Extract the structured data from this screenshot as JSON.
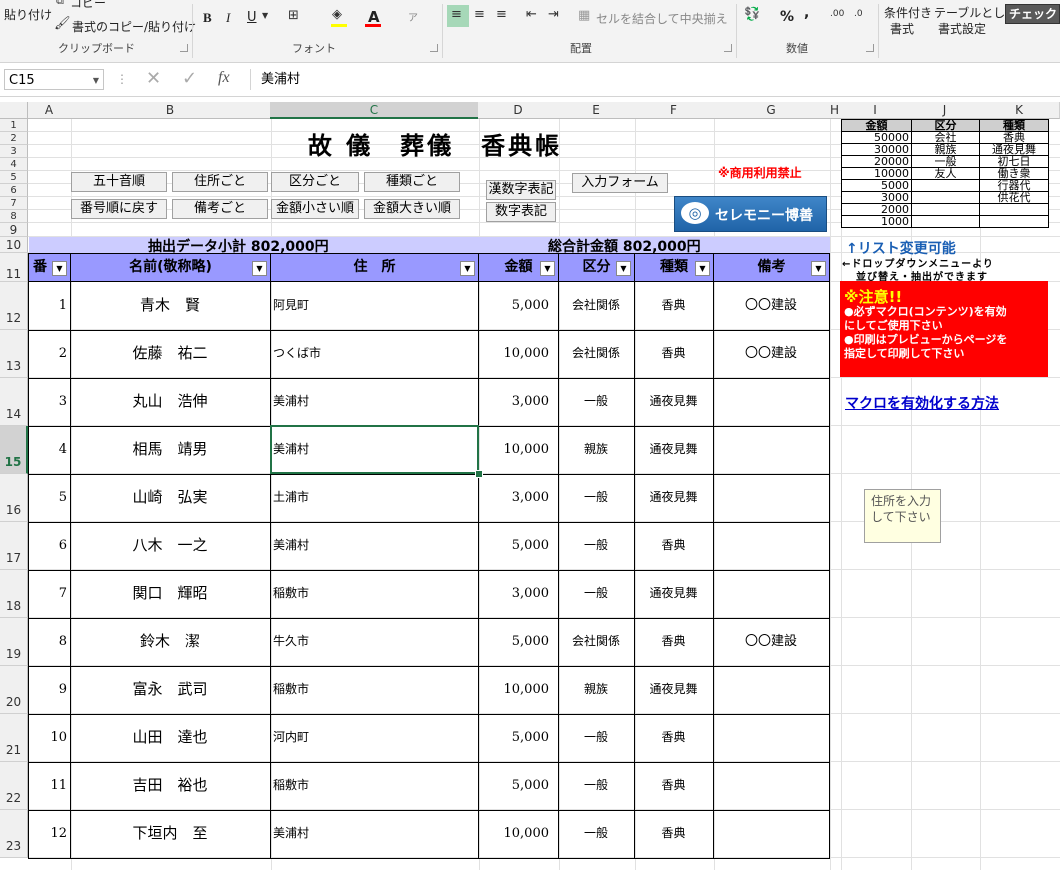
{
  "ribbon": {
    "paste_label": "貼り付け",
    "copy_label": "コピー",
    "format_painter_label": "書式のコピー/貼り付け",
    "clipboard_group": "クリップボード",
    "font_group": "フォント",
    "bold": "B",
    "italic": "I",
    "underline": "U",
    "font_color_letter": "A",
    "alignment_group": "配置",
    "merge_center_label": "セルを結合して中央揃え",
    "number_group": "数値",
    "percent": "%",
    "comma": ",",
    "conditional_format_line1": "条件付き",
    "conditional_format_line2": "書式",
    "table_format_line1": "テーブルとして",
    "table_format_line2": "書式設定",
    "check_label": "チェック"
  },
  "formula_bar": {
    "name_box": "C15",
    "fx": "fx",
    "content": "美浦村"
  },
  "columns": [
    "A",
    "B",
    "C",
    "D",
    "E",
    "F",
    "G",
    "H",
    "I",
    "J",
    "K"
  ],
  "sheet": {
    "title": "故 儀　葬儀　香典帳",
    "buttons": {
      "gojuon": "五十音順",
      "by_address": "住所ごと",
      "by_category": "区分ごと",
      "by_type": "種類ごと",
      "kanji_numerals": "漢数字表記",
      "input_form": "入力フォーム",
      "back_to_number": "番号順に戻す",
      "by_remarks": "備考ごと",
      "amount_asc": "金額小さい順",
      "amount_desc": "金額大きい順",
      "digit_numerals": "数字表記"
    },
    "commercial_notice": "※商用利用禁止",
    "logo_text": "セレモニー博善",
    "subtotal_label": "抽出データ小計 802,000円",
    "total_label": "総合計金額 802,000円",
    "headers": {
      "number": "番",
      "name": "名前(敬称略)",
      "address": "住　所",
      "amount": "金額",
      "category": "区分",
      "type": "種類",
      "remarks": "備考"
    },
    "rows": [
      {
        "row": "12",
        "no": "1",
        "name": "青木　賢",
        "address": "阿見町",
        "amount": "5,000",
        "category": "会社関係",
        "type": "香典",
        "remarks": "〇〇建設"
      },
      {
        "row": "13",
        "no": "2",
        "name": "佐藤　祐二",
        "address": "つくば市",
        "amount": "10,000",
        "category": "会社関係",
        "type": "香典",
        "remarks": "〇〇建設"
      },
      {
        "row": "14",
        "no": "3",
        "name": "丸山　浩伸",
        "address": "美浦村",
        "amount": "3,000",
        "category": "一般",
        "type": "通夜見舞",
        "remarks": ""
      },
      {
        "row": "15",
        "no": "4",
        "name": "相馬　靖男",
        "address": "美浦村",
        "amount": "10,000",
        "category": "親族",
        "type": "通夜見舞",
        "remarks": ""
      },
      {
        "row": "16",
        "no": "5",
        "name": "山崎　弘実",
        "address": "土浦市",
        "amount": "3,000",
        "category": "一般",
        "type": "通夜見舞",
        "remarks": ""
      },
      {
        "row": "17",
        "no": "6",
        "name": "八木　一之",
        "address": "美浦村",
        "amount": "5,000",
        "category": "一般",
        "type": "香典",
        "remarks": ""
      },
      {
        "row": "18",
        "no": "7",
        "name": "関口　輝昭",
        "address": "稲敷市",
        "amount": "3,000",
        "category": "一般",
        "type": "通夜見舞",
        "remarks": ""
      },
      {
        "row": "19",
        "no": "8",
        "name": "鈴木　潔",
        "address": "牛久市",
        "amount": "5,000",
        "category": "会社関係",
        "type": "香典",
        "remarks": "〇〇建設"
      },
      {
        "row": "20",
        "no": "9",
        "name": "富永　武司",
        "address": "稲敷市",
        "amount": "10,000",
        "category": "親族",
        "type": "通夜見舞",
        "remarks": ""
      },
      {
        "row": "21",
        "no": "10",
        "name": "山田　達也",
        "address": "河内町",
        "amount": "5,000",
        "category": "一般",
        "type": "香典",
        "remarks": ""
      },
      {
        "row": "22",
        "no": "11",
        "name": "吉田　裕也",
        "address": "稲敷市",
        "amount": "5,000",
        "category": "一般",
        "type": "香典",
        "remarks": ""
      },
      {
        "row": "23",
        "no": "12",
        "name": "下垣内　至",
        "address": "美浦村",
        "amount": "10,000",
        "category": "一般",
        "type": "香典",
        "remarks": ""
      }
    ],
    "lookup": {
      "headers": [
        "金額",
        "区分",
        "種類"
      ],
      "amounts": [
        "50000",
        "30000",
        "20000",
        "10000",
        "5000",
        "3000",
        "2000",
        "1000"
      ],
      "categories": [
        "会社",
        "親族",
        "一般",
        "友人",
        "",
        "",
        "",
        ""
      ],
      "types": [
        "香典",
        "通夜見舞",
        "初七日",
        "働き衆",
        "行器代",
        "供花代",
        "",
        ""
      ]
    },
    "list_editable": "↑リスト変更可能",
    "dropdown_hint1": "←ドロップダウンメニューより",
    "dropdown_hint2": "並び替え・抽出ができます",
    "warning_title": "※注意!!",
    "warning_line1": "●必ずマクロ(コンテンツ)を有効",
    "warning_line2": "にしてご使用下さい",
    "warning_line3": "●印刷はプレビューからページを",
    "warning_line4": "指定して印刷して下さい",
    "macro_link": "マクロを有効化する方法",
    "tooltip_line1": "住所を入力",
    "tooltip_line2": "して下さい"
  },
  "colors": {
    "header_fill": "#9999ff",
    "subtotal_fill": "#ccccff",
    "warning_fill": "#ff0000",
    "excel_green": "#217346",
    "link_blue": "#0000cc"
  }
}
